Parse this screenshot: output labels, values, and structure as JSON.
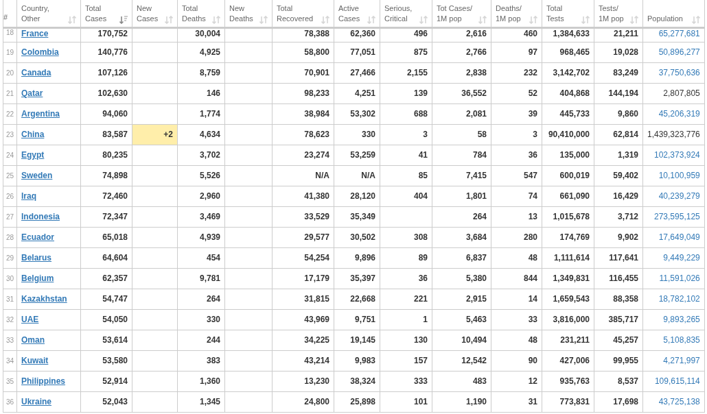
{
  "table": {
    "columns": [
      {
        "label": "#"
      },
      {
        "label": "Country, Other",
        "sorted": false
      },
      {
        "label": "Total Cases",
        "sorted": true
      },
      {
        "label": "New Cases",
        "sorted": false
      },
      {
        "label": "Total Deaths",
        "sorted": false
      },
      {
        "label": "New Deaths",
        "sorted": false
      },
      {
        "label": "Total Recovered",
        "sorted": false
      },
      {
        "label": "Active Cases",
        "sorted": false
      },
      {
        "label": "Serious, Critical",
        "sorted": false
      },
      {
        "label": "Tot Cases/ 1M pop",
        "sorted": false
      },
      {
        "label": "Deaths/ 1M pop",
        "sorted": false
      },
      {
        "label": "Total Tests",
        "sorted": false
      },
      {
        "label": "Tests/ 1M pop",
        "sorted": false
      },
      {
        "label": "Population",
        "sorted": false
      }
    ],
    "rows": [
      {
        "cells": [
          "18",
          "France",
          "170,752",
          null,
          "30,004",
          null,
          "78,388",
          "62,360",
          "496",
          "2,616",
          "460",
          "1,384,633",
          "21,211",
          "65,277,681"
        ],
        "population_link": true
      },
      {
        "cells": [
          "19",
          "Colombia",
          "140,776",
          null,
          "4,925",
          null,
          "58,800",
          "77,051",
          "875",
          "2,766",
          "97",
          "968,465",
          "19,028",
          "50,896,277"
        ],
        "population_link": true
      },
      {
        "cells": [
          "20",
          "Canada",
          "107,126",
          null,
          "8,759",
          null,
          "70,901",
          "27,466",
          "2,155",
          "2,838",
          "232",
          "3,142,702",
          "83,249",
          "37,750,636"
        ],
        "population_link": true
      },
      {
        "cells": [
          "21",
          "Qatar",
          "102,630",
          null,
          "146",
          null,
          "98,233",
          "4,251",
          "139",
          "36,552",
          "52",
          "404,868",
          "144,194",
          "2,807,805"
        ],
        "population_link": false
      },
      {
        "cells": [
          "22",
          "Argentina",
          "94,060",
          null,
          "1,774",
          null,
          "38,984",
          "53,302",
          "688",
          "2,081",
          "39",
          "445,733",
          "9,860",
          "45,206,319"
        ],
        "population_link": true
      },
      {
        "cells": [
          "23",
          "China",
          "83,587",
          "+2",
          "4,634",
          null,
          "78,623",
          "330",
          "3",
          "58",
          "3",
          "90,410,000",
          "62,814",
          "1,439,323,776"
        ],
        "population_link": false
      },
      {
        "cells": [
          "24",
          "Egypt",
          "80,235",
          null,
          "3,702",
          null,
          "23,274",
          "53,259",
          "41",
          "784",
          "36",
          "135,000",
          "1,319",
          "102,373,924"
        ],
        "population_link": true
      },
      {
        "cells": [
          "25",
          "Sweden",
          "74,898",
          null,
          "5,526",
          null,
          "N/A",
          "N/A",
          "85",
          "7,415",
          "547",
          "600,019",
          "59,402",
          "10,100,959"
        ],
        "population_link": true
      },
      {
        "cells": [
          "26",
          "Iraq",
          "72,460",
          null,
          "2,960",
          null,
          "41,380",
          "28,120",
          "404",
          "1,801",
          "74",
          "661,090",
          "16,429",
          "40,239,279"
        ],
        "population_link": true
      },
      {
        "cells": [
          "27",
          "Indonesia",
          "72,347",
          null,
          "3,469",
          null,
          "33,529",
          "35,349",
          null,
          "264",
          "13",
          "1,015,678",
          "3,712",
          "273,595,125"
        ],
        "population_link": true
      },
      {
        "cells": [
          "28",
          "Ecuador",
          "65,018",
          null,
          "4,939",
          null,
          "29,577",
          "30,502",
          "308",
          "3,684",
          "280",
          "174,769",
          "9,902",
          "17,649,049"
        ],
        "population_link": true
      },
      {
        "cells": [
          "29",
          "Belarus",
          "64,604",
          null,
          "454",
          null,
          "54,254",
          "9,896",
          "89",
          "6,837",
          "48",
          "1,111,614",
          "117,641",
          "9,449,229"
        ],
        "population_link": true
      },
      {
        "cells": [
          "30",
          "Belgium",
          "62,357",
          null,
          "9,781",
          null,
          "17,179",
          "35,397",
          "36",
          "5,380",
          "844",
          "1,349,831",
          "116,455",
          "11,591,026"
        ],
        "population_link": true
      },
      {
        "cells": [
          "31",
          "Kazakhstan",
          "54,747",
          null,
          "264",
          null,
          "31,815",
          "22,668",
          "221",
          "2,915",
          "14",
          "1,659,543",
          "88,358",
          "18,782,102"
        ],
        "population_link": true
      },
      {
        "cells": [
          "32",
          "UAE",
          "54,050",
          null,
          "330",
          null,
          "43,969",
          "9,751",
          "1",
          "5,463",
          "33",
          "3,816,000",
          "385,717",
          "9,893,265"
        ],
        "population_link": true
      },
      {
        "cells": [
          "33",
          "Oman",
          "53,614",
          null,
          "244",
          null,
          "34,225",
          "19,145",
          "130",
          "10,494",
          "48",
          "231,211",
          "45,257",
          "5,108,835"
        ],
        "population_link": true
      },
      {
        "cells": [
          "34",
          "Kuwait",
          "53,580",
          null,
          "383",
          null,
          "43,214",
          "9,983",
          "157",
          "12,542",
          "90",
          "427,006",
          "99,955",
          "4,271,997"
        ],
        "population_link": true
      },
      {
        "cells": [
          "35",
          "Philippines",
          "52,914",
          null,
          "1,360",
          null,
          "13,230",
          "38,324",
          "333",
          "483",
          "12",
          "935,763",
          "8,537",
          "109,615,114"
        ],
        "population_link": true
      },
      {
        "cells": [
          "36",
          "Ukraine",
          "52,043",
          null,
          "1,345",
          null,
          "24,800",
          "25,898",
          "101",
          "1,190",
          "31",
          "773,831",
          "17,698",
          "43,725,138"
        ],
        "population_link": true
      }
    ]
  }
}
